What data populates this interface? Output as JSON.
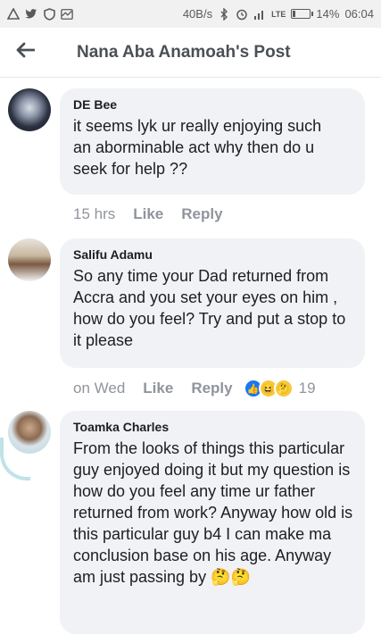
{
  "status_bar": {
    "speed": "40B/s",
    "network": "LTE",
    "battery": "14%",
    "time": "06:04",
    "icons": [
      "warning-icon",
      "twitter-icon",
      "shield-icon",
      "pulse-icon",
      "bluetooth-icon",
      "alarm-icon",
      "signal-icon"
    ]
  },
  "header": {
    "title": "Nana Aba Anamoah's Post",
    "back_icon": "back-arrow-icon"
  },
  "comments": [
    {
      "author": "DE Bee",
      "text": "it seems lyk ur really enjoying such an aborminable act why then do u seek for help ??",
      "time": "15 hrs",
      "like": "Like",
      "reply": "Reply"
    },
    {
      "author": "Salifu Adamu",
      "text": "So any time your Dad returned from Accra and you set your eyes on him , how do you feel? Try and put a stop to it please",
      "time": "on Wed",
      "like": "Like",
      "reply": "Reply",
      "reaction_count": "19",
      "reactions": [
        "like-reaction",
        "haha-reaction",
        "thinking-reaction"
      ]
    },
    {
      "author": "Toamka Charles",
      "text": "From the looks of things this particular guy enjoyed doing it but my question is how do you feel any time ur father returned from work? Anyway how old is this particular guy b4 I can make ma conclusion base on his age. Anyway am just passing by",
      "emoji": "🤔🤔"
    }
  ]
}
